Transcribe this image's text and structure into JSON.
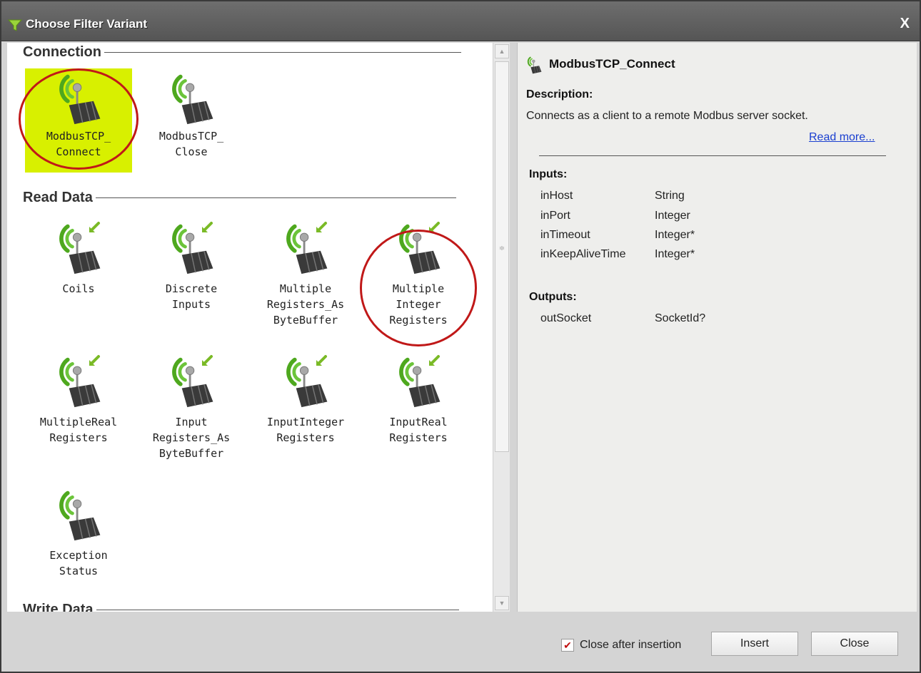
{
  "window": {
    "title": "Choose Filter Variant",
    "close_glyph": "X"
  },
  "sections": {
    "connection": "Connection",
    "read_data": "Read Data",
    "write_data": "Write Data"
  },
  "items": {
    "connect": "ModbusTCP_\nConnect",
    "close": "ModbusTCP_\nClose",
    "coils": "Coils",
    "discrete_inputs": "Discrete\nInputs",
    "multiple_registers_bytebuffer": "Multiple\nRegisters_As\nByteBuffer",
    "multiple_integer_registers": "Multiple\nInteger\nRegisters",
    "multiple_real_registers": "MultipleReal\nRegisters",
    "input_registers_bytebuffer": "Input\nRegisters_As\nByteBuffer",
    "input_integer_registers": "InputInteger\nRegisters",
    "input_real_registers": "InputReal\nRegisters",
    "exception_status": "Exception\nStatus"
  },
  "selected_item": "ModbusTCP_Connect",
  "details": {
    "title": "ModbusTCP_Connect",
    "description_heading": "Description:",
    "description": "Connects as a client to a remote Modbus server socket.",
    "read_more": "Read more...",
    "inputs_heading": "Inputs:",
    "inputs": [
      {
        "name": "inHost",
        "type": "String"
      },
      {
        "name": "inPort",
        "type": "Integer"
      },
      {
        "name": "inTimeout",
        "type": "Integer*"
      },
      {
        "name": "inKeepAliveTime",
        "type": "Integer*"
      }
    ],
    "outputs_heading": "Outputs:",
    "outputs": [
      {
        "name": "outSocket",
        "type": "SocketId?"
      }
    ]
  },
  "footer": {
    "close_after_insertion_label": "Close after insertion",
    "close_after_insertion_checked": true,
    "check_glyph": "✔",
    "insert_label": "Insert",
    "close_label": "Close"
  },
  "colors": {
    "selection_highlight": "#d8f000",
    "annotation_circle": "#c01818",
    "link": "#1a3fd0"
  },
  "icons": {
    "title": "filter-icon",
    "connection_item": "modbus-antenna-icon",
    "read_item": "modbus-read-antenna-icon"
  }
}
